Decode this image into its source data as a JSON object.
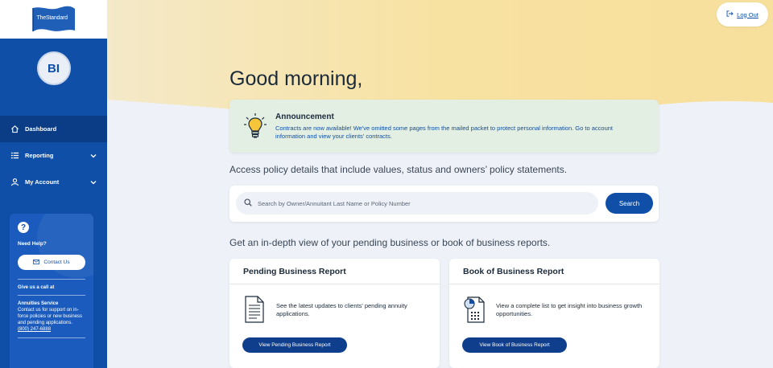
{
  "brand": {
    "logo_text": "TheStandard",
    "color": "#0f4fa8"
  },
  "user": {
    "initials": "BI"
  },
  "sidebar": {
    "items": [
      {
        "label": "Dashboard",
        "icon": "home-icon",
        "active": true
      },
      {
        "label": "Reporting",
        "icon": "list-icon",
        "expandable": true
      },
      {
        "label": "My Account",
        "icon": "user-icon",
        "expandable": true
      }
    ],
    "help": {
      "icon": "question-icon",
      "title": "Need Help?",
      "contact_label": "Contact Us",
      "call_label": "Give us a call at",
      "service_title": "Annuities Service",
      "service_desc": "Contact us for support on in-force policies or new business and pending applications.",
      "phone": "(800) 247-6888"
    }
  },
  "header": {
    "logout_label": "Log Out"
  },
  "main": {
    "greeting": "Good morning,",
    "announcement": {
      "title": "Announcement",
      "text": "Contracts are now available! We've omitted some pages from the mailed packet to protect personal information. Go to account information and view your clients' contracts."
    },
    "access_text": "Access policy details that include values, status and owners’ policy statements.",
    "search": {
      "placeholder": "Search by Owner/Annuitant Last Name or Policy Number",
      "value": "",
      "button_label": "Search"
    },
    "pending_text": "Get an in-depth view of your pending business or book of business reports.",
    "cards": [
      {
        "title": "Pending Business Report",
        "description": "See the latest updates to clients' pending annuity applications.",
        "button_label": "View Pending Business Report",
        "icon": "document-icon"
      },
      {
        "title": "Book of Business Report",
        "description": "View a complete list to get insight into business growth opportunities.",
        "button_label": "View Book of Business Report",
        "icon": "report-chart-icon"
      }
    ]
  },
  "colors": {
    "sidebar_bg": "#0f4fa8",
    "accent": "#0f4fa8",
    "hero_yellow": "#f7e3a6",
    "announcement_bg": "#e3efe2",
    "page_bg": "#eef2f8"
  }
}
